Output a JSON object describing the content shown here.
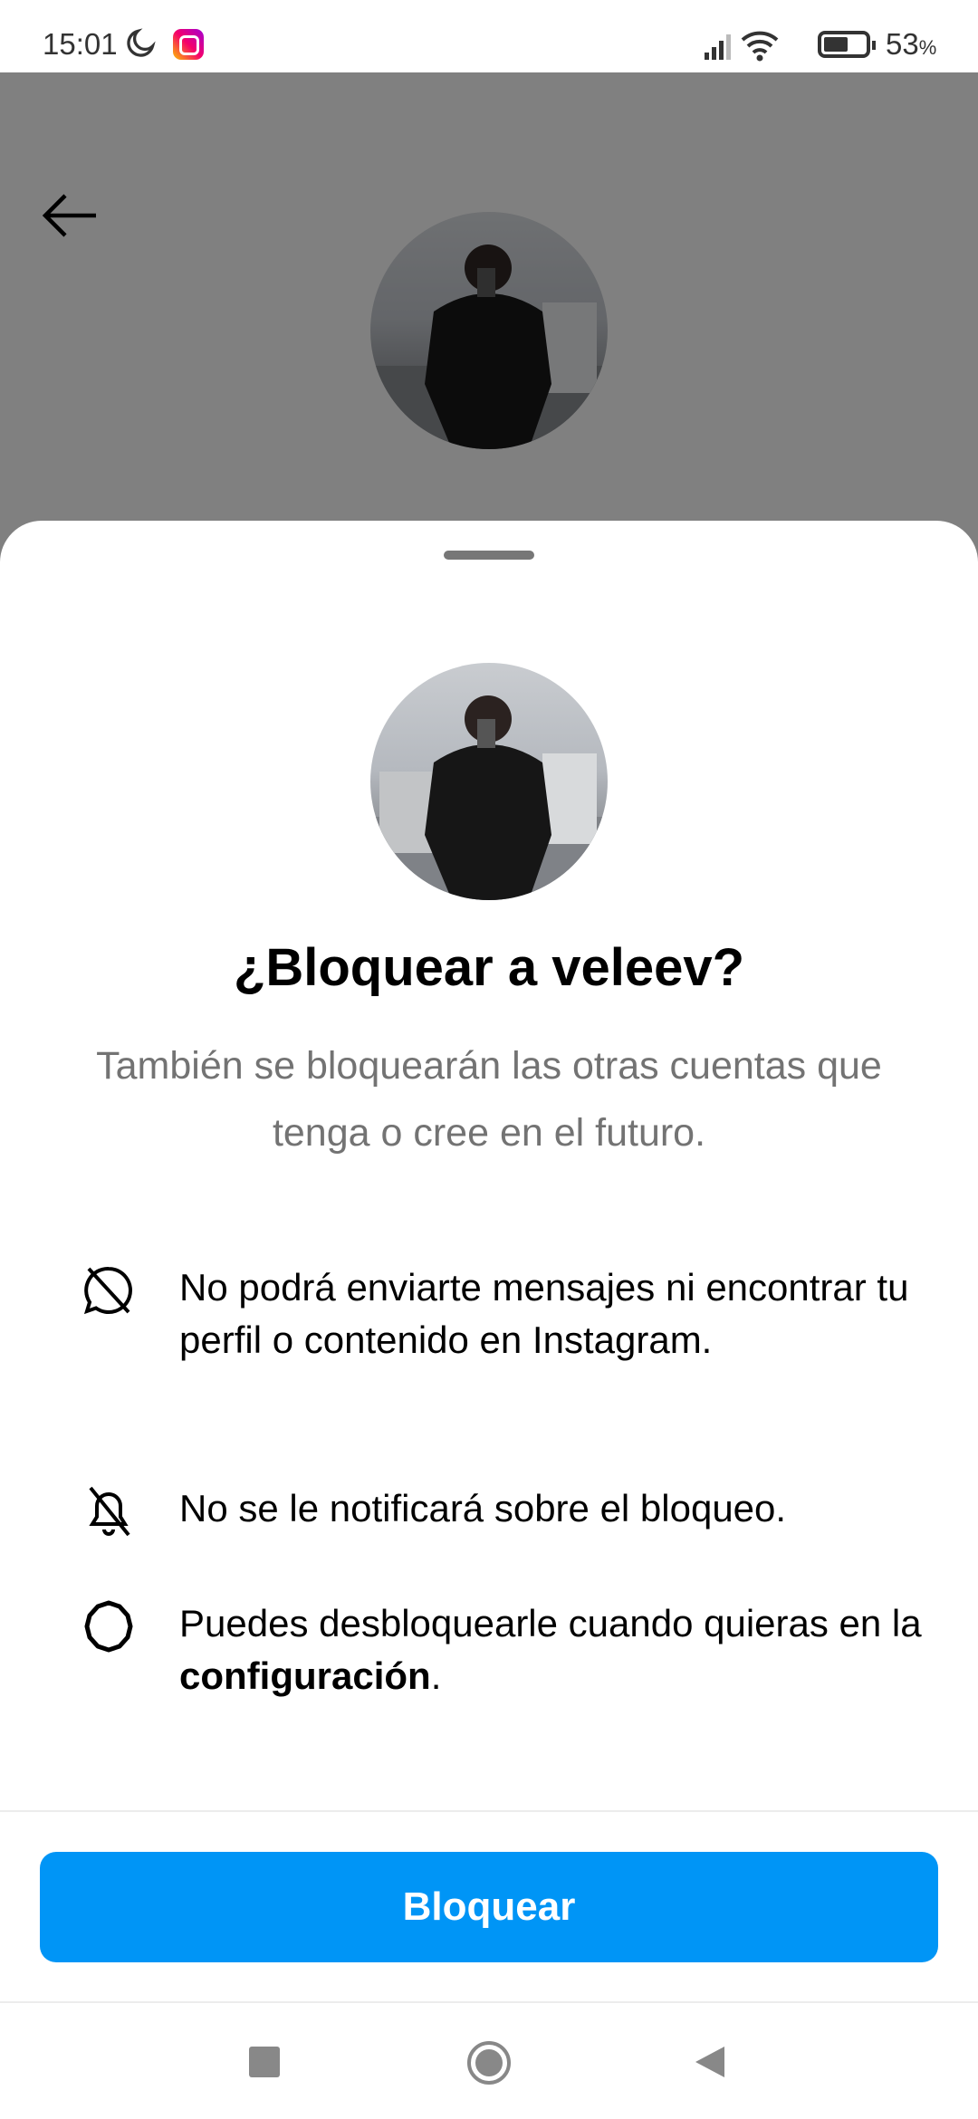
{
  "status_bar": {
    "time": "15:01",
    "battery_percent": "53",
    "battery_symbol": "%",
    "icons": [
      "moon-icon",
      "instagram-icon",
      "signal-icon",
      "wifi-icon",
      "battery-icon"
    ]
  },
  "sheet": {
    "title": "¿Bloquear a veleev?",
    "subtitle": "También se bloquearán las otras cuentas que tenga o cree en el futuro.",
    "items": [
      {
        "icon": "message-off-icon",
        "text": "No podrá enviarte mensajes ni encontrar tu perfil o contenido en Instagram."
      },
      {
        "icon": "bell-off-icon",
        "text": "No se le notificará sobre el bloqueo."
      },
      {
        "icon": "settings-gear-icon",
        "text_before": "Puedes desbloquearle cuando quieras en la ",
        "text_bold": "configuración",
        "text_after": "."
      }
    ],
    "block_button": "Bloquear"
  },
  "colors": {
    "accent": "#0095f6",
    "overlay": "#808080",
    "subtitle": "#737373"
  }
}
